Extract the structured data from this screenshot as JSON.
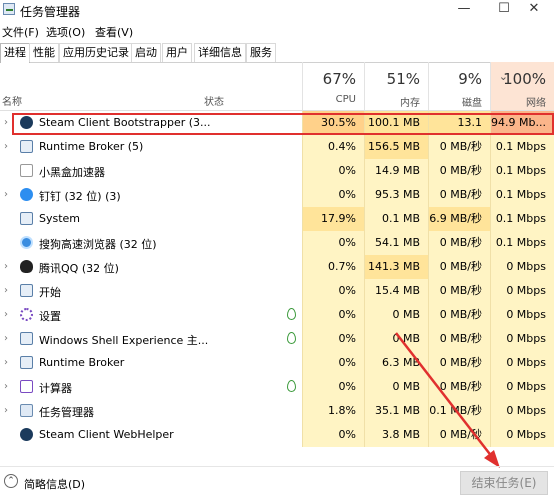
{
  "window": {
    "title": "任务管理器",
    "buttons": [
      "—",
      "☐",
      "✕"
    ]
  },
  "menu": [
    "文件(F)",
    "选项(O)",
    "查看(V)"
  ],
  "tabs": [
    "进程",
    "性能",
    "应用历史记录",
    "启动",
    "用户",
    "详细信息",
    "服务"
  ],
  "columns": {
    "name": "名称",
    "status": "状态",
    "cpu": {
      "pct": "67%",
      "label": "CPU"
    },
    "mem": {
      "pct": "51%",
      "label": "内存"
    },
    "disk": {
      "pct": "9%",
      "label": "磁盘"
    },
    "net": {
      "pct": "100%",
      "label": "网络",
      "sort_arrow": "⌄"
    }
  },
  "processes": [
    {
      "name": "Steam Client Bootstrapper (3...",
      "cpu": "30.5%",
      "mem": "100.1 MB",
      "disk": "13.1 MB...",
      "net": "94.9 Mb...",
      "icon": "steam",
      "expand": true,
      "leaf": false
    },
    {
      "name": "Runtime Broker (5)",
      "cpu": "0.4%",
      "mem": "156.5 MB",
      "disk": "0 MB/秒",
      "net": "0.1 Mbps",
      "icon": "window",
      "expand": true,
      "leaf": false
    },
    {
      "name": "小黑盒加速器",
      "cpu": "0%",
      "mem": "14.9 MB",
      "disk": "0 MB/秒",
      "net": "0.1 Mbps",
      "icon": "box",
      "expand": false,
      "leaf": false
    },
    {
      "name": "钉钉 (32 位) (3)",
      "cpu": "0%",
      "mem": "95.3 MB",
      "disk": "0 MB/秒",
      "net": "0.1 Mbps",
      "icon": "dingtalk",
      "expand": true,
      "leaf": false
    },
    {
      "name": "System",
      "cpu": "17.9%",
      "mem": "0.1 MB",
      "disk": "6.9 MB/秒",
      "net": "0.1 Mbps",
      "icon": "window",
      "expand": false,
      "leaf": false
    },
    {
      "name": "搜狗高速浏览器 (32 位)",
      "cpu": "0%",
      "mem": "54.1 MB",
      "disk": "0 MB/秒",
      "net": "0.1 Mbps",
      "icon": "sogou",
      "expand": false,
      "leaf": false
    },
    {
      "name": "腾讯QQ (32 位)",
      "cpu": "0.7%",
      "mem": "141.3 MB",
      "disk": "0 MB/秒",
      "net": "0 Mbps",
      "icon": "qq",
      "expand": true,
      "leaf": false
    },
    {
      "name": "开始",
      "cpu": "0%",
      "mem": "15.4 MB",
      "disk": "0 MB/秒",
      "net": "0 Mbps",
      "icon": "window",
      "expand": true,
      "leaf": false
    },
    {
      "name": "设置",
      "cpu": "0%",
      "mem": "0 MB",
      "disk": "0 MB/秒",
      "net": "0 Mbps",
      "icon": "gear",
      "expand": true,
      "leaf": true
    },
    {
      "name": "Windows Shell Experience 主...",
      "cpu": "0%",
      "mem": "0 MB",
      "disk": "0 MB/秒",
      "net": "0 Mbps",
      "icon": "window",
      "expand": true,
      "leaf": true
    },
    {
      "name": "Runtime Broker",
      "cpu": "0%",
      "mem": "6.3 MB",
      "disk": "0 MB/秒",
      "net": "0 Mbps",
      "icon": "window",
      "expand": true,
      "leaf": false
    },
    {
      "name": "计算器",
      "cpu": "0%",
      "mem": "0 MB",
      "disk": "0 MB/秒",
      "net": "0 Mbps",
      "icon": "calc",
      "expand": true,
      "leaf": true
    },
    {
      "name": "任务管理器",
      "cpu": "1.8%",
      "mem": "35.1 MB",
      "disk": "0.1 MB/秒",
      "net": "0 Mbps",
      "icon": "taskmgr",
      "expand": true,
      "leaf": false
    },
    {
      "name": "Steam Client WebHelper",
      "cpu": "0%",
      "mem": "3.8 MB",
      "disk": "0 MB/秒",
      "net": "0 Mbps",
      "icon": "steam",
      "expand": false,
      "leaf": false
    }
  ],
  "footer": {
    "fewer_details": "简略信息(D)",
    "end_task": "结束任务(E)"
  },
  "colors": {
    "highlight": "#e0302e",
    "annotation_arrow": "#e0302e"
  }
}
